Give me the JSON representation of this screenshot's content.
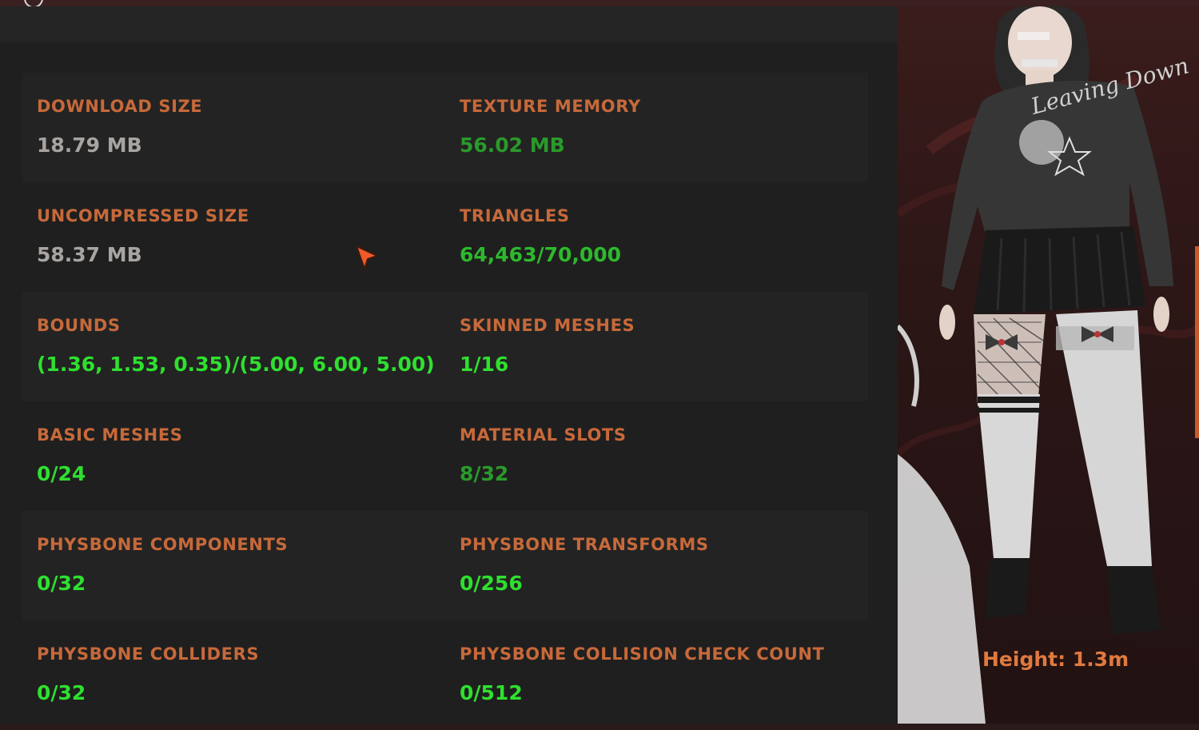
{
  "stats": [
    {
      "label": "DOWNLOAD SIZE",
      "value": "18.79 MB",
      "color": "gray"
    },
    {
      "label": "TEXTURE MEMORY",
      "value": "56.02 MB",
      "color": "dark"
    },
    {
      "label": "UNCOMPRESSED SIZE",
      "value": "58.37 MB",
      "color": "gray"
    },
    {
      "label": "TRIANGLES",
      "value": "64,463/70,000",
      "color": "mid"
    },
    {
      "label": "BOUNDS",
      "value": "(1.36, 1.53, 0.35)/(5.00, 6.00, 5.00)",
      "color": "bright"
    },
    {
      "label": "SKINNED MESHES",
      "value": "1/16",
      "color": "bright"
    },
    {
      "label": "BASIC MESHES",
      "value": "0/24",
      "color": "bright"
    },
    {
      "label": "MATERIAL SLOTS",
      "value": "8/32",
      "color": "dark"
    },
    {
      "label": "PHYSBONE COMPONENTS",
      "value": "0/32",
      "color": "bright"
    },
    {
      "label": "PHYSBONE TRANSFORMS",
      "value": "0/256",
      "color": "bright"
    },
    {
      "label": "PHYSBONE COLLIDERS",
      "value": "0/32",
      "color": "bright"
    },
    {
      "label": "PHYSBONE COLLISION CHECK COUNT",
      "value": "0/512",
      "color": "bright"
    }
  ],
  "preview": {
    "height_label": "Height: 1.3m",
    "shirt_text": "Leaving Down"
  },
  "colors": {
    "label": "#c7693a",
    "value_gray": "#a8a4a1",
    "value_bright": "#2fe02f",
    "value_mid": "#2db92d",
    "value_dark": "#2a9a2a",
    "accent": "#e07a3f"
  }
}
